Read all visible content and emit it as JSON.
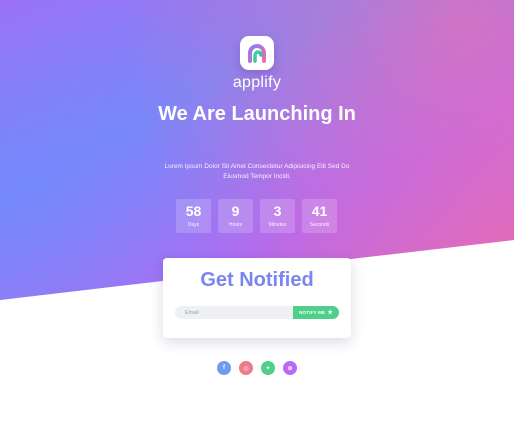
{
  "brand": {
    "name": "applify"
  },
  "headline": "We Are Launching In",
  "subtext": "Lorem Ipsum Dolor Sit Amet Consectetur Adipisicing Elit Sed Do Eiusmod Tempor Incidi.",
  "countdown": [
    {
      "value": "58",
      "label": "Days"
    },
    {
      "value": "9",
      "label": "Hours"
    },
    {
      "value": "3",
      "label": "Minutes"
    },
    {
      "value": "41",
      "label": "Seconds"
    }
  ],
  "notify": {
    "title": "Get Notified",
    "email_placeholder": "Email",
    "button_label": "NOTIFY ME"
  },
  "socials": [
    {
      "name": "facebook-icon",
      "glyph": "f",
      "color": "#6f9bf2"
    },
    {
      "name": "instagram-icon",
      "glyph": "◎",
      "color": "#f07a8c"
    },
    {
      "name": "twitter-icon",
      "glyph": "✦",
      "color": "#4fd08a"
    },
    {
      "name": "dribbble-icon",
      "glyph": "⊛",
      "color": "#b46cf0"
    }
  ],
  "colors": {
    "accent": "#7a86ee",
    "button": "#4fd08a"
  }
}
